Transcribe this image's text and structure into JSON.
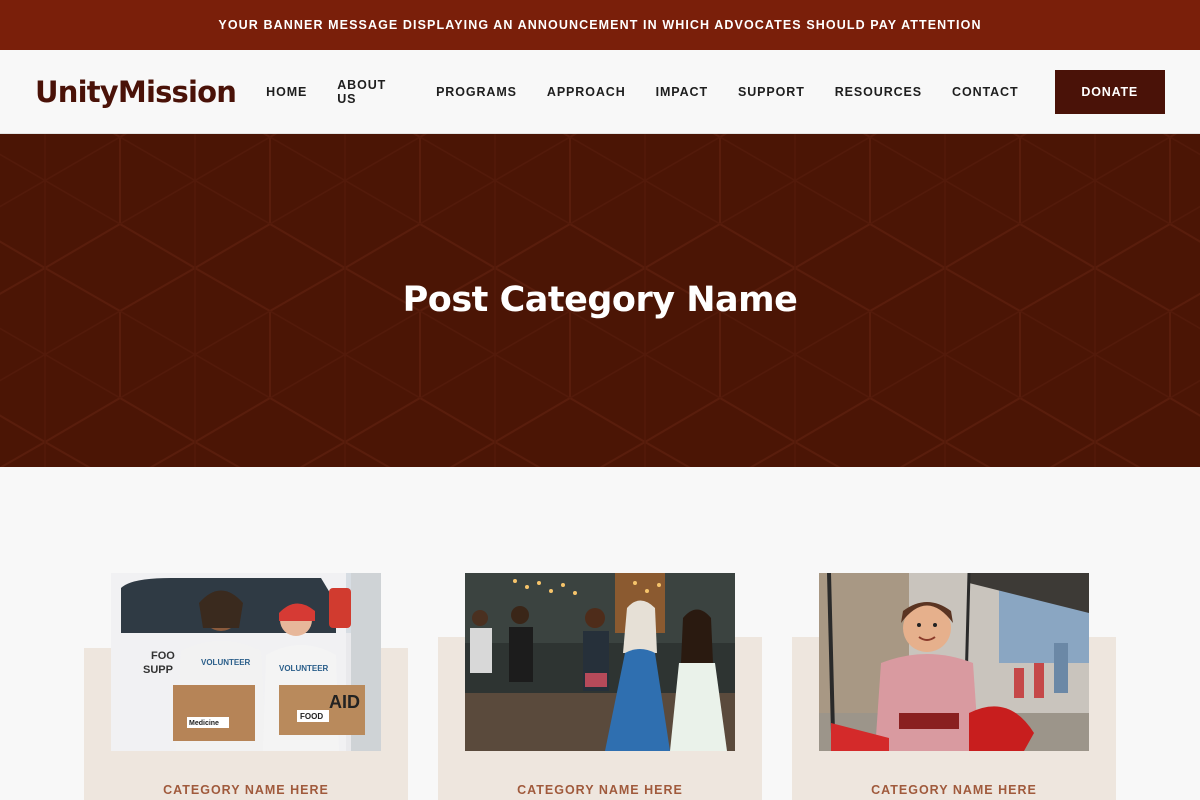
{
  "banner": {
    "text": "YOUR BANNER MESSAGE DISPLAYING AN ANNOUNCEMENT IN WHICH ADVOCATES SHOULD PAY ATTENTION"
  },
  "header": {
    "logo": "UnityMission",
    "nav": [
      {
        "label": "HOME"
      },
      {
        "label": "ABOUT US"
      },
      {
        "label": "PROGRAMS"
      },
      {
        "label": "APPROACH"
      },
      {
        "label": "IMPACT"
      },
      {
        "label": "SUPPORT"
      },
      {
        "label": "RESOURCES"
      },
      {
        "label": "CONTACT"
      }
    ],
    "donate_label": "DONATE"
  },
  "hero": {
    "title": "Post Category Name"
  },
  "cards": [
    {
      "category": "CATEGORY NAME HERE",
      "image": "volunteers-with-aid-boxes-photo",
      "image_text": {
        "van_line1": "FOO",
        "van_line2": "SUPP",
        "shirt1": "VOLUNTEER",
        "shirt2": "VOLUNTEER",
        "box1": "Medicine",
        "box2_big": "AID",
        "box2": "FOOD"
      }
    },
    {
      "category": "CATEGORY NAME HERE",
      "image": "community-gathering-photo"
    },
    {
      "category": "CATEGORY NAME HERE",
      "image": "child-on-swing-photo"
    }
  ],
  "colors": {
    "banner": "#7a1f0a",
    "brand_dark": "#4a1208",
    "hero_bg": "#4b1505",
    "card_bg": "#eee6de",
    "category_text": "#a05a3c"
  }
}
